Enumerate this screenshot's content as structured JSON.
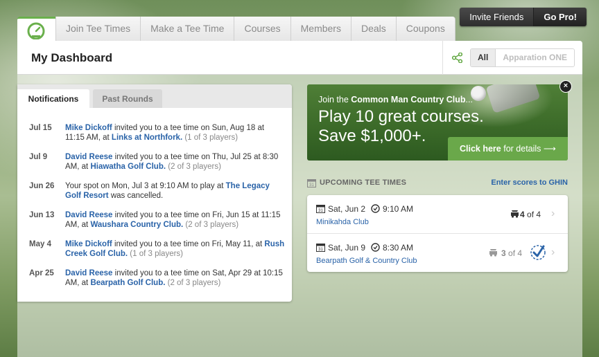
{
  "top_actions": {
    "invite": "Invite Friends",
    "pro": "Go Pro!"
  },
  "nav": {
    "tabs": [
      "Join Tee Times",
      "Make a Tee Time",
      "Courses",
      "Members",
      "Deals",
      "Coupons"
    ]
  },
  "header": {
    "title": "My Dashboard",
    "filter_all": "All",
    "filter_other": "Apparation ONE"
  },
  "notifications": {
    "tabs": [
      "Notifications",
      "Past Rounds"
    ],
    "items": [
      {
        "date": "Jul 15",
        "who": "Mike Dickoff",
        "text": " invited you to a tee time on Sun, Aug 18 at 11:15 AM, at ",
        "place": "Links at Northfork.",
        "count": " (1 of 3 players)"
      },
      {
        "date": "Jul 9",
        "who": "David Reese",
        "text": " invited you to a tee time on Thu, Jul 25 at 8:30 AM, at ",
        "place": "Hiawatha Golf Club.",
        "count": " (2 of 3 players)"
      },
      {
        "date": "Jun 26",
        "who": "",
        "text": "Your spot on Mon, Jul 3 at 9:10 AM to play at ",
        "place": "The Legacy Golf Resort",
        "count": " was cancelled."
      },
      {
        "date": "Jun 13",
        "who": "David Reese",
        "text": " invited you to a tee time on Fri, Jun 15 at 11:15 AM, at ",
        "place": "Waushara Country Club.",
        "count": " (2 of 3 players)"
      },
      {
        "date": "May 4",
        "who": "Mike Dickoff",
        "text": " invited you to a tee time on Fri, May 11, at ",
        "place": "Rush Creek Golf Club.",
        "count": " (1 of 3 players)"
      },
      {
        "date": "Apr 25",
        "who": "David Reese",
        "text": " invited you to a tee time on Sat, Apr 29 at 10:15 AM, at ",
        "place": "Bearpath Golf Club.",
        "count": " (2 of 3 players)"
      }
    ]
  },
  "promo": {
    "line1_prefix": "Join the ",
    "line1_bold": "Common Man Country Club",
    "line1_suffix": "...",
    "line2": "Play 10 great courses.",
    "line3": "Save $1,000+.",
    "cta_bold": "Click here",
    "cta_rest": " for details ⟶",
    "close": "×"
  },
  "upcoming": {
    "title": "UPCOMING TEE TIMES",
    "ghin_link": "Enter scores to GHIN",
    "rows": [
      {
        "day": "Sat, Jun 2",
        "time": "9:10 AM",
        "club": "Minikahda Club",
        "filled": "4",
        "of": " of 4"
      },
      {
        "day": "Sat, Jun 9",
        "time": "8:30 AM",
        "club": "Bearpath Golf & Country Club",
        "filled": "3",
        "of": " of 4"
      }
    ]
  },
  "colors": {
    "accent_green": "#6aa84a",
    "link_blue": "#2a63a8"
  }
}
